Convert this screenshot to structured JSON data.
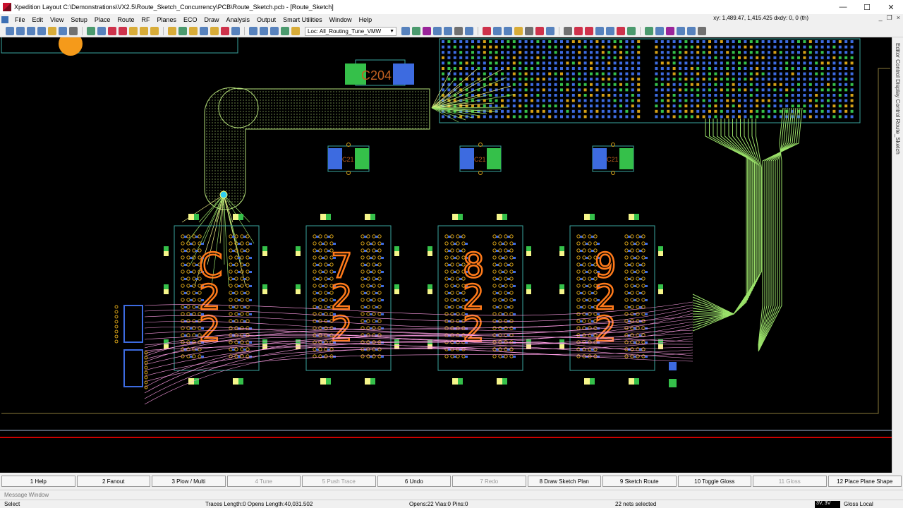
{
  "window": {
    "title": "Xpedition Layout  C:\\Demonstrations\\VX2.5\\Route_Sketch_Concurrency\\PCB\\Route_Sketch.pcb - [Route_Sketch]",
    "minimize": "—",
    "maximize": "☐",
    "close": "✕"
  },
  "menu": {
    "items": [
      "File",
      "Edit",
      "View",
      "Setup",
      "Place",
      "Route",
      "RF",
      "Planes",
      "ECO",
      "Draw",
      "Analysis",
      "Output",
      "Smart Utilities",
      "Window",
      "Help"
    ],
    "coords": "xy: 1,489.47, 1,415.425  dxdy: 0, 0  (th)",
    "doc_min": "_",
    "doc_restore": "❐",
    "doc_close": "×"
  },
  "toolbar": {
    "loc_value": "Loc: All_Routing_Tune_VMW",
    "icon_colors": [
      "#3c6fb4",
      "#3c6fb4",
      "#3c6fb4",
      "#3c6fb4",
      "#d4a017",
      "#3c6fb4",
      "#5a5a5a",
      "#2e8b57",
      "#3c6fb4",
      "#c8102e",
      "#c8102e",
      "#d4a017",
      "#d4a017",
      "#d4a017",
      "#d4a017",
      "#2e8b57",
      "#d4a017",
      "#3c6fb4",
      "#d4a017",
      "#c8102e",
      "#3c6fb4",
      "#3c6fb4",
      "#3c6fb4",
      "#3c6fb4",
      "#2e8b57",
      "#d4a017"
    ],
    "icon_colors_right": [
      "#3c6fb4",
      "#2e8b57",
      "#8b008b",
      "#3c6fb4",
      "#3c6fb4",
      "#5a5a5a",
      "#3c6fb4",
      "#c8102e",
      "#3c6fb4",
      "#3c6fb4",
      "#d4a017",
      "#5a5a5a",
      "#c8102e",
      "#3c6fb4",
      "#5a5a5a",
      "#c8102e",
      "#c8102e",
      "#3c6fb4",
      "#3c6fb4",
      "#c8102e",
      "#2e8b57",
      "#2e8b57",
      "#3c6fb4",
      "#8b008b",
      "#3c6fb4",
      "#3c6fb4",
      "#5a5a5a"
    ]
  },
  "canvas": {
    "labels": {
      "c204": "C204",
      "c21a": "C21",
      "c21b": "C21",
      "c21c": "C21"
    },
    "colors": {
      "background": "#000000",
      "outline": "#b5e07a",
      "trace_green": "#9be26a",
      "pad_blue": "#3d6be0",
      "pad_green": "#35c04a",
      "pin_yellow": "#f5f58a",
      "silk_orange": "#ff7a1a",
      "ratsnest_pink": "#ff9ee6",
      "via_orange": "#d4a017",
      "board_edge": "#8a7a3a",
      "plane_red": "#cc0000",
      "outline_teal": "#3aa6a0"
    }
  },
  "side_tab": {
    "label": "Editor Control  Display Control  Route_Sketch"
  },
  "fkeys": [
    {
      "label": "1 Help",
      "enabled": true
    },
    {
      "label": "2 Fanout",
      "enabled": true
    },
    {
      "label": "3 Plow / Multi",
      "enabled": true
    },
    {
      "label": "4 Tune",
      "enabled": false
    },
    {
      "label": "5 Push Trace",
      "enabled": false
    },
    {
      "label": "6 Undo",
      "enabled": true
    },
    {
      "label": "7 Redo",
      "enabled": false
    },
    {
      "label": "8 Draw Sketch Plan",
      "enabled": true
    },
    {
      "label": "9 Sketch Route",
      "enabled": true
    },
    {
      "label": "10 Toggle Gloss",
      "enabled": true
    },
    {
      "label": "11 Gloss",
      "enabled": false
    },
    {
      "label": "12 Place Plane Shape",
      "enabled": true
    }
  ],
  "message_window": "Message Window",
  "status": {
    "mode": "Select",
    "traces": "Traces Length:0 Opens Length:40,031.502",
    "opens": "Opens:22 Vias:0 Pins:0",
    "selected": "22  nets selected",
    "layer": "3V, 3V",
    "gloss": "Gloss Local"
  }
}
